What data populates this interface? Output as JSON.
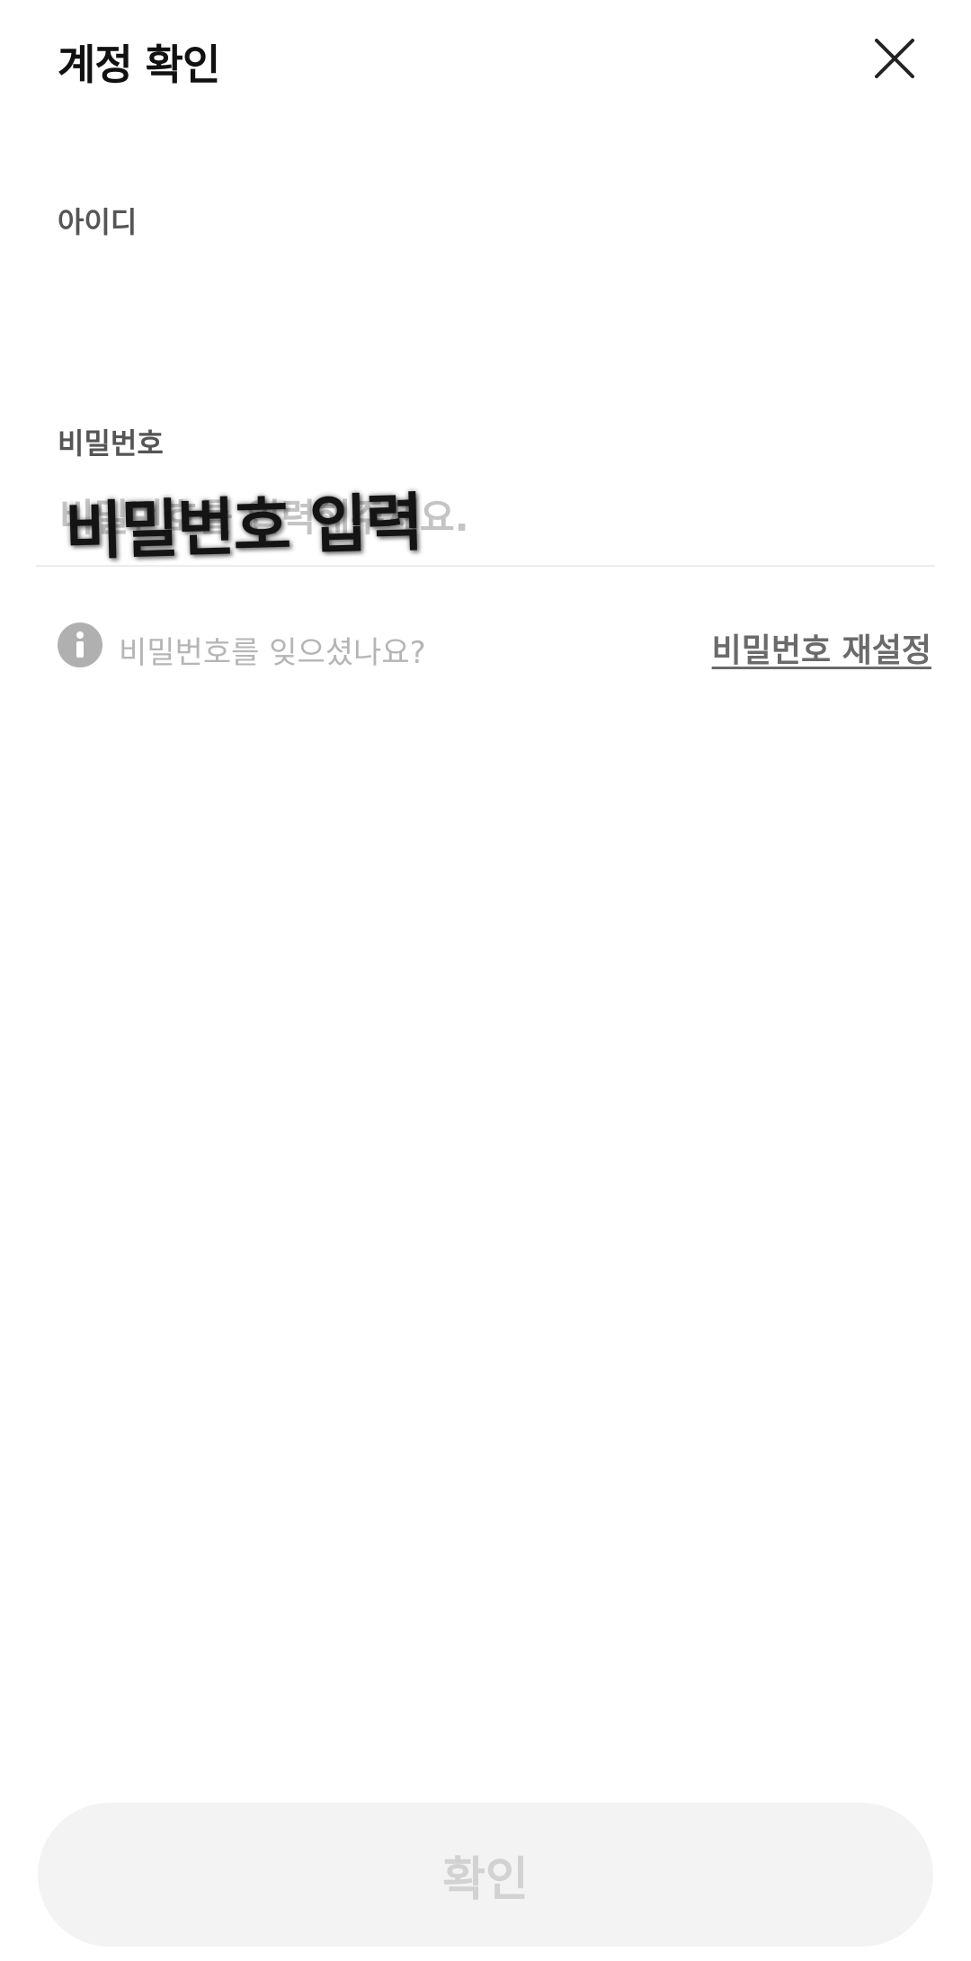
{
  "header": {
    "title": "계정 확인",
    "close_icon": "close-icon"
  },
  "form": {
    "id_label": "아이디",
    "password_label": "비밀번호",
    "password_placeholder": "비밀번호를 입력해주세요.",
    "password_annotation": "비밀번호 입력"
  },
  "forgot": {
    "info_icon": "info-icon",
    "text": "비밀번호를 잊으셨나요?",
    "reset_link": "비밀번호 재설정"
  },
  "footer": {
    "confirm_label": "확인"
  }
}
